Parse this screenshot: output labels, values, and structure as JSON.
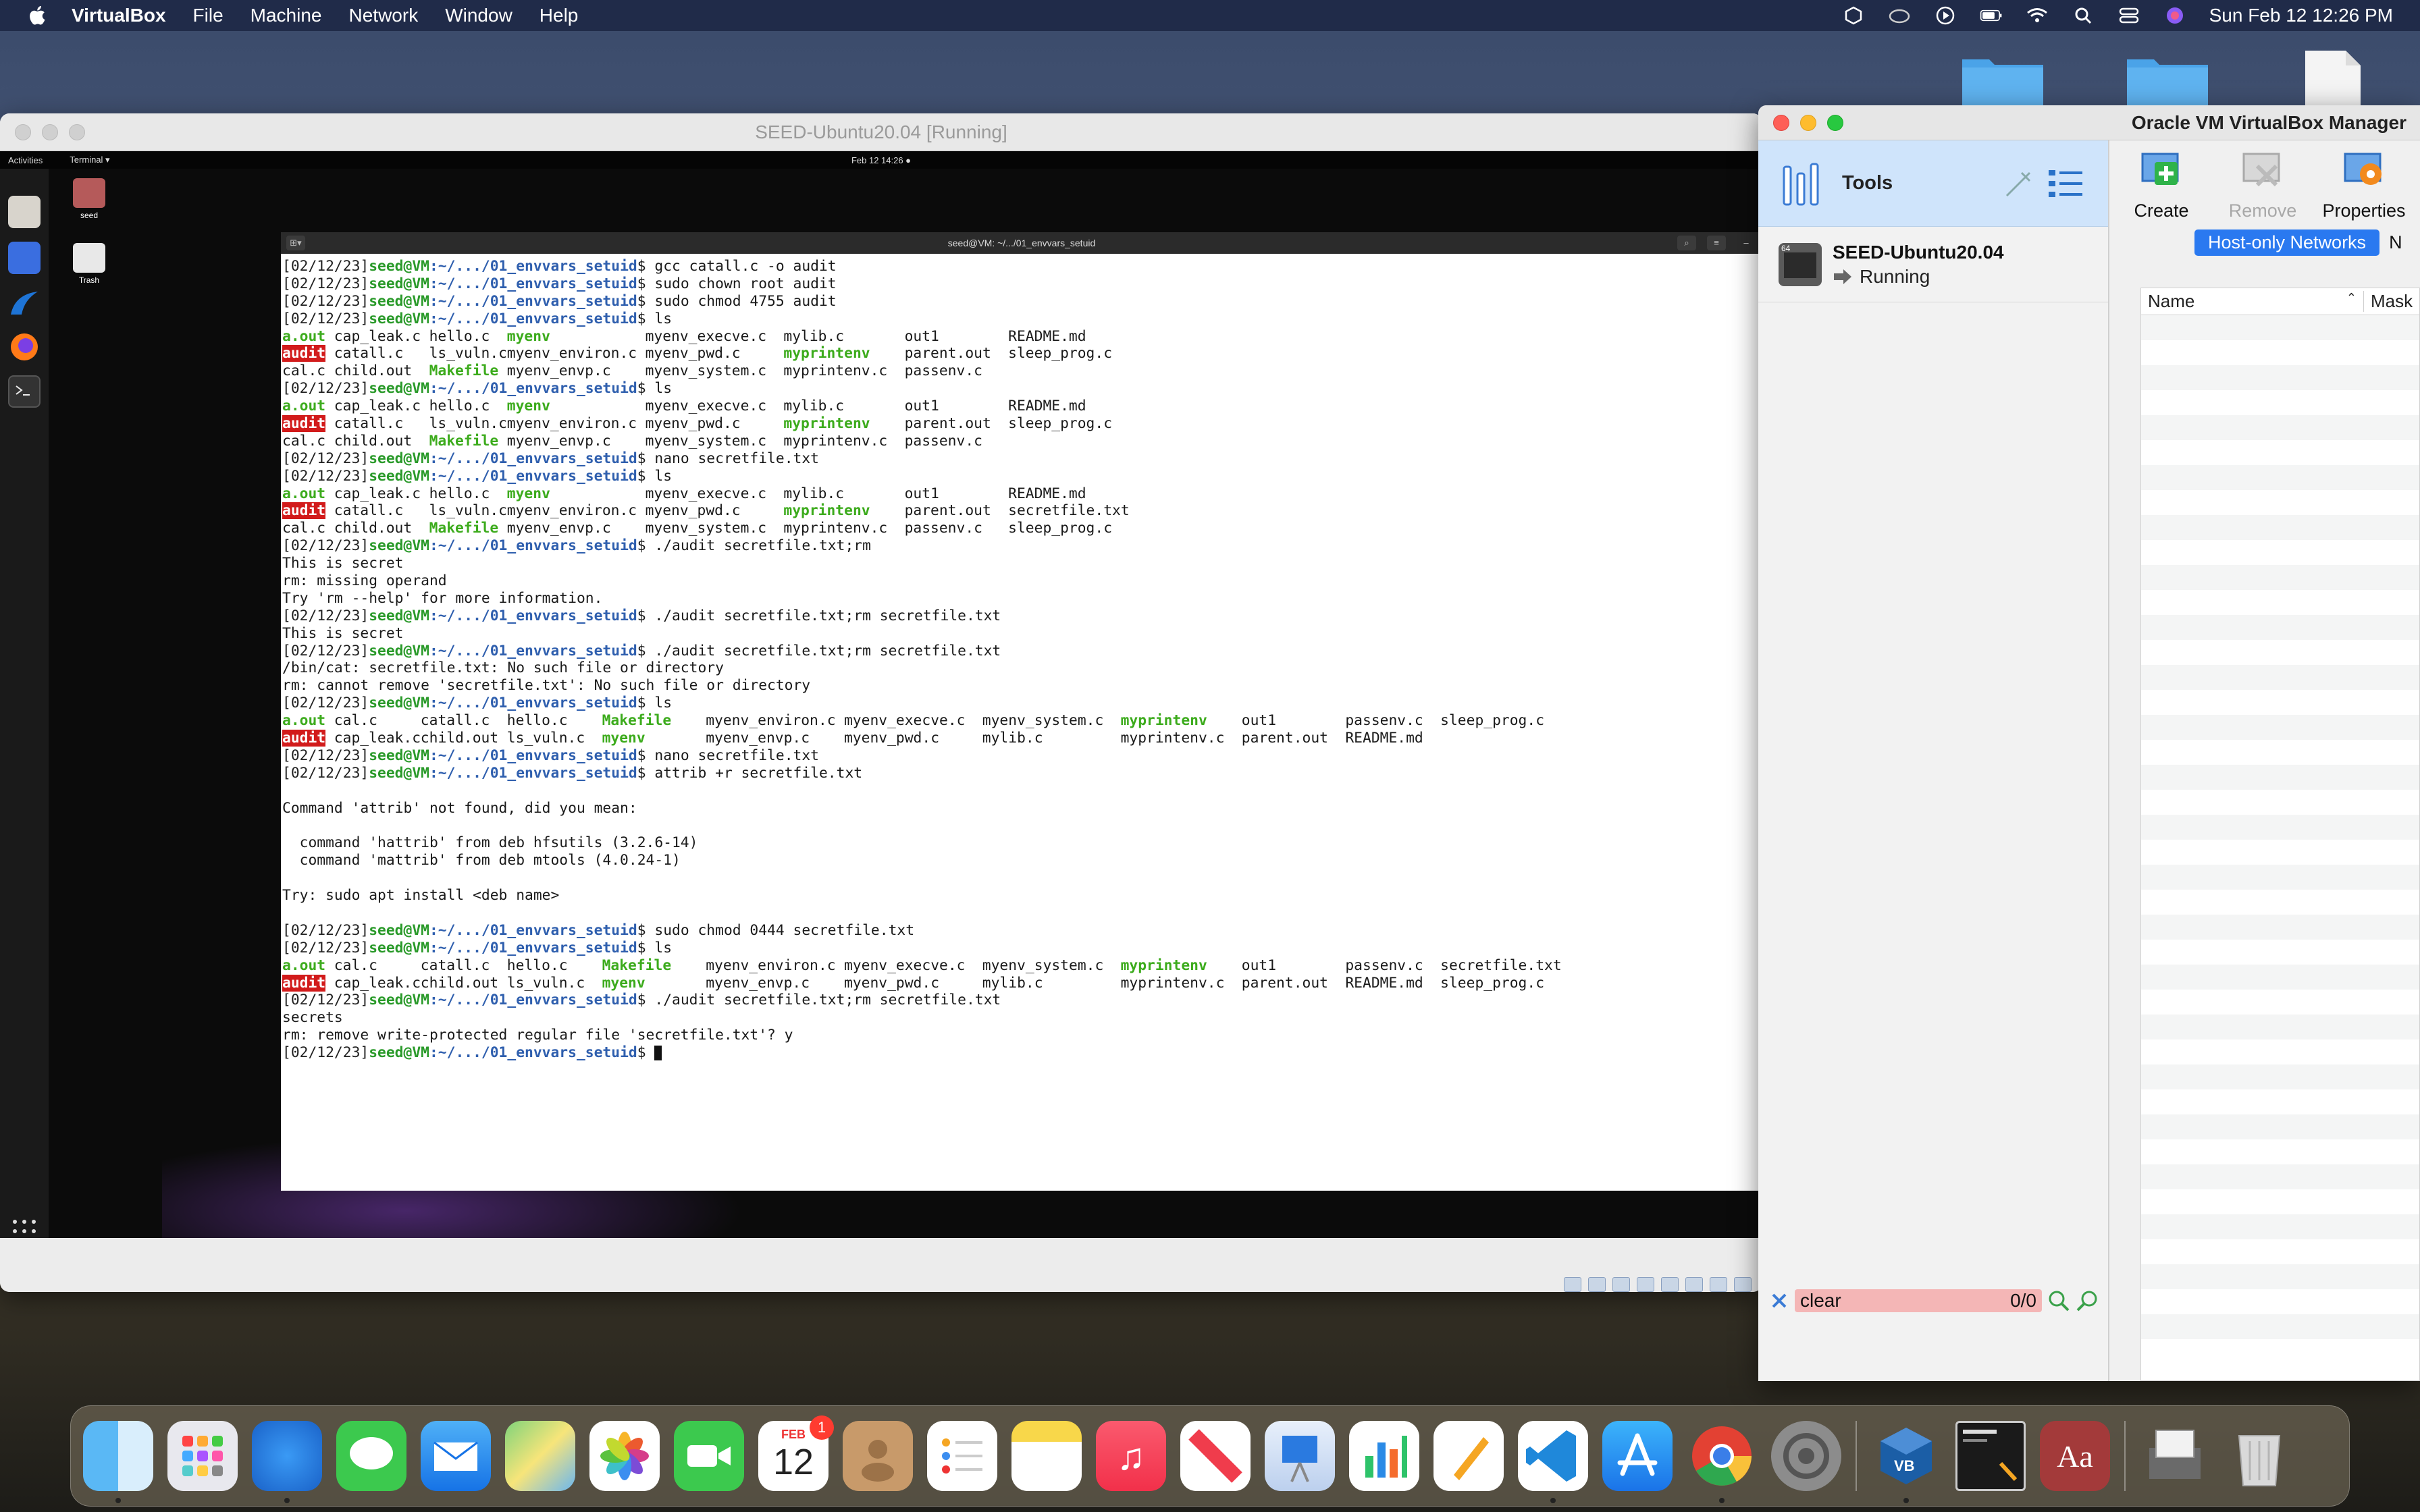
{
  "menubar": {
    "app": "VirtualBox",
    "items": [
      "File",
      "Machine",
      "Network",
      "Window",
      "Help"
    ],
    "datetime": "Sun Feb 12  12:26 PM"
  },
  "vm_window": {
    "title": "SEED-Ubuntu20.04 [Running]",
    "gnome": {
      "activities": "Activities",
      "app_menu": "Terminal ▾",
      "clock": "Feb 12  14:26  ●"
    },
    "desktop_icons": [
      "seed",
      "Trash"
    ],
    "terminal_title": "seed@VM: ~/.../01_envvars_setuid"
  },
  "terminal": {
    "prompt_date": "[02/12/23]",
    "prompt_user": "seed@VM",
    "prompt_path": ":~/.../01_envvars_setuid",
    "lines": [
      {
        "t": "cmd",
        "text": "gcc catall.c -o audit"
      },
      {
        "t": "cmd",
        "text": "sudo chown root audit"
      },
      {
        "t": "cmd",
        "text": "sudo chmod 4755 audit"
      },
      {
        "t": "cmd",
        "text": "ls"
      },
      {
        "t": "ls",
        "cols": [
          [
            [
              "a.out",
              "g"
            ],
            [
              "cap_leak.c",
              ""
            ],
            [
              "hello.c",
              ""
            ],
            [
              "myenv",
              "g"
            ],
            [
              "myenv_execve.c",
              ""
            ],
            [
              "mylib.c",
              ""
            ],
            [
              "out1",
              ""
            ],
            [
              "README.md",
              ""
            ]
          ]
        ]
      },
      {
        "t": "ls",
        "cols": [
          [
            [
              "audit",
              "a"
            ],
            [
              "catall.c",
              ""
            ],
            [
              "ls_vuln.c",
              ""
            ],
            [
              "myenv_environ.c",
              ""
            ],
            [
              "myenv_pwd.c",
              ""
            ],
            [
              "myprintenv",
              "g"
            ],
            [
              "parent.out",
              ""
            ],
            [
              "sleep_prog.c",
              ""
            ]
          ]
        ]
      },
      {
        "t": "ls",
        "cols": [
          [
            [
              "cal.c",
              ""
            ],
            [
              "child.out",
              ""
            ],
            [
              "Makefile",
              "g"
            ],
            [
              "myenv_envp.c",
              ""
            ],
            [
              "myenv_system.c",
              ""
            ],
            [
              "myprintenv.c",
              ""
            ],
            [
              "passenv.c",
              ""
            ],
            [
              "",
              ""
            ]
          ]
        ]
      },
      {
        "t": "cmd",
        "text": "ls"
      },
      {
        "t": "ls",
        "cols": [
          [
            [
              "a.out",
              "g"
            ],
            [
              "cap_leak.c",
              ""
            ],
            [
              "hello.c",
              ""
            ],
            [
              "myenv",
              "g"
            ],
            [
              "myenv_execve.c",
              ""
            ],
            [
              "mylib.c",
              ""
            ],
            [
              "out1",
              ""
            ],
            [
              "README.md",
              ""
            ]
          ]
        ]
      },
      {
        "t": "ls",
        "cols": [
          [
            [
              "audit",
              "a"
            ],
            [
              "catall.c",
              ""
            ],
            [
              "ls_vuln.c",
              ""
            ],
            [
              "myenv_environ.c",
              ""
            ],
            [
              "myenv_pwd.c",
              ""
            ],
            [
              "myprintenv",
              "g"
            ],
            [
              "parent.out",
              ""
            ],
            [
              "sleep_prog.c",
              ""
            ]
          ]
        ]
      },
      {
        "t": "ls",
        "cols": [
          [
            [
              "cal.c",
              ""
            ],
            [
              "child.out",
              ""
            ],
            [
              "Makefile",
              "g"
            ],
            [
              "myenv_envp.c",
              ""
            ],
            [
              "myenv_system.c",
              ""
            ],
            [
              "myprintenv.c",
              ""
            ],
            [
              "passenv.c",
              ""
            ],
            [
              "",
              ""
            ]
          ]
        ]
      },
      {
        "t": "cmd",
        "text": "nano secretfile.txt"
      },
      {
        "t": "cmd",
        "text": "ls"
      },
      {
        "t": "ls",
        "cols": [
          [
            [
              "a.out",
              "g"
            ],
            [
              "cap_leak.c",
              ""
            ],
            [
              "hello.c",
              ""
            ],
            [
              "myenv",
              "g"
            ],
            [
              "myenv_execve.c",
              ""
            ],
            [
              "mylib.c",
              ""
            ],
            [
              "out1",
              ""
            ],
            [
              "README.md",
              ""
            ]
          ]
        ]
      },
      {
        "t": "ls",
        "cols": [
          [
            [
              "audit",
              "a"
            ],
            [
              "catall.c",
              ""
            ],
            [
              "ls_vuln.c",
              ""
            ],
            [
              "myenv_environ.c",
              ""
            ],
            [
              "myenv_pwd.c",
              ""
            ],
            [
              "myprintenv",
              "g"
            ],
            [
              "parent.out",
              ""
            ],
            [
              "secretfile.txt",
              ""
            ]
          ]
        ]
      },
      {
        "t": "ls",
        "cols": [
          [
            [
              "cal.c",
              ""
            ],
            [
              "child.out",
              ""
            ],
            [
              "Makefile",
              "g"
            ],
            [
              "myenv_envp.c",
              ""
            ],
            [
              "myenv_system.c",
              ""
            ],
            [
              "myprintenv.c",
              ""
            ],
            [
              "passenv.c",
              ""
            ],
            [
              "sleep_prog.c",
              ""
            ]
          ]
        ]
      },
      {
        "t": "cmd",
        "text": "./audit secretfile.txt;rm"
      },
      {
        "t": "out",
        "text": "This is secret"
      },
      {
        "t": "out",
        "text": "rm: missing operand"
      },
      {
        "t": "out",
        "text": "Try 'rm --help' for more information."
      },
      {
        "t": "cmd",
        "text": "./audit secretfile.txt;rm secretfile.txt"
      },
      {
        "t": "out",
        "text": "This is secret"
      },
      {
        "t": "cmd",
        "text": "./audit secretfile.txt;rm secretfile.txt"
      },
      {
        "t": "out",
        "text": "/bin/cat: secretfile.txt: No such file or directory"
      },
      {
        "t": "out",
        "text": "rm: cannot remove 'secretfile.txt': No such file or directory"
      },
      {
        "t": "cmd",
        "text": "ls"
      },
      {
        "t": "ls2",
        "cols": [
          [
            [
              "a.out",
              "g"
            ],
            [
              "cal.c",
              ""
            ],
            [
              "catall.c",
              ""
            ],
            [
              "hello.c",
              ""
            ],
            [
              "Makefile",
              "g"
            ],
            [
              "myenv_environ.c",
              ""
            ],
            [
              "myenv_execve.c",
              ""
            ],
            [
              "myenv_system.c",
              ""
            ],
            [
              "myprintenv",
              "g"
            ],
            [
              "out1",
              ""
            ],
            [
              "passenv.c",
              ""
            ],
            [
              "sleep_prog.c",
              ""
            ]
          ]
        ]
      },
      {
        "t": "ls2",
        "cols": [
          [
            [
              "audit",
              "a"
            ],
            [
              "cap_leak.c",
              ""
            ],
            [
              "child.out",
              ""
            ],
            [
              "ls_vuln.c",
              ""
            ],
            [
              "myenv",
              "g"
            ],
            [
              "myenv_envp.c",
              ""
            ],
            [
              "myenv_pwd.c",
              ""
            ],
            [
              "mylib.c",
              ""
            ],
            [
              "myprintenv.c",
              ""
            ],
            [
              "parent.out",
              ""
            ],
            [
              "README.md",
              ""
            ],
            [
              "",
              ""
            ]
          ]
        ]
      },
      {
        "t": "cmd",
        "text": "nano secretfile.txt"
      },
      {
        "t": "cmd",
        "text": "attrib +r secretfile.txt"
      },
      {
        "t": "out",
        "text": ""
      },
      {
        "t": "out",
        "text": "Command 'attrib' not found, did you mean:"
      },
      {
        "t": "out",
        "text": ""
      },
      {
        "t": "out",
        "text": "  command 'hattrib' from deb hfsutils (3.2.6-14)"
      },
      {
        "t": "out",
        "text": "  command 'mattrib' from deb mtools (4.0.24-1)"
      },
      {
        "t": "out",
        "text": ""
      },
      {
        "t": "out",
        "text": "Try: sudo apt install <deb name>"
      },
      {
        "t": "out",
        "text": ""
      },
      {
        "t": "cmd",
        "text": "sudo chmod 0444 secretfile.txt"
      },
      {
        "t": "cmd",
        "text": "ls"
      },
      {
        "t": "ls2",
        "cols": [
          [
            [
              "a.out",
              "g"
            ],
            [
              "cal.c",
              ""
            ],
            [
              "catall.c",
              ""
            ],
            [
              "hello.c",
              ""
            ],
            [
              "Makefile",
              "g"
            ],
            [
              "myenv_environ.c",
              ""
            ],
            [
              "myenv_execve.c",
              ""
            ],
            [
              "myenv_system.c",
              ""
            ],
            [
              "myprintenv",
              "g"
            ],
            [
              "out1",
              ""
            ],
            [
              "passenv.c",
              ""
            ],
            [
              "secretfile.txt",
              ""
            ]
          ]
        ]
      },
      {
        "t": "ls2",
        "cols": [
          [
            [
              "audit",
              "a"
            ],
            [
              "cap_leak.c",
              ""
            ],
            [
              "child.out",
              ""
            ],
            [
              "ls_vuln.c",
              ""
            ],
            [
              "myenv",
              "g"
            ],
            [
              "myenv_envp.c",
              ""
            ],
            [
              "myenv_pwd.c",
              ""
            ],
            [
              "mylib.c",
              ""
            ],
            [
              "myprintenv.c",
              ""
            ],
            [
              "parent.out",
              ""
            ],
            [
              "README.md",
              ""
            ],
            [
              "sleep_prog.c",
              ""
            ]
          ]
        ]
      },
      {
        "t": "cmd",
        "text": "./audit secretfile.txt;rm secretfile.txt"
      },
      {
        "t": "out",
        "text": "secrets"
      },
      {
        "t": "out",
        "text": "rm: remove write-protected regular file 'secretfile.txt'? y"
      },
      {
        "t": "cmd",
        "text": "",
        "cursor": true
      }
    ]
  },
  "manager": {
    "title": "Oracle VM VirtualBox Manager",
    "tools_label": "Tools",
    "vm": {
      "name": "SEED-Ubuntu20.04",
      "state": "Running"
    },
    "toolbar": {
      "create": "Create",
      "remove": "Remove",
      "properties": "Properties"
    },
    "tabs": {
      "active": "Host-only Networks",
      "next": "N"
    },
    "table": {
      "col_name": "Name",
      "col_mask": "Mask"
    },
    "filter": {
      "value": "clear",
      "count": "0/0"
    }
  },
  "dock": {
    "calendar": {
      "month": "FEB",
      "day": "12",
      "badge": "1"
    },
    "apps": [
      "finder-icon",
      "launchpad-icon",
      "safari-icon",
      "messages-icon",
      "mail-icon",
      "maps-icon",
      "photos-icon",
      "facetime-icon",
      "calendar-icon",
      "contacts-icon",
      "reminders-icon",
      "notes-icon",
      "music-icon",
      "news-icon",
      "keynote-icon",
      "numbers-icon",
      "pages-icon",
      "vscode-icon",
      "app-store-icon",
      "chrome-icon",
      "system-preferences-icon",
      "virtualbox-icon",
      "vm-window-icon",
      "dictionary-icon",
      "preview-icon",
      "trash-icon"
    ]
  }
}
